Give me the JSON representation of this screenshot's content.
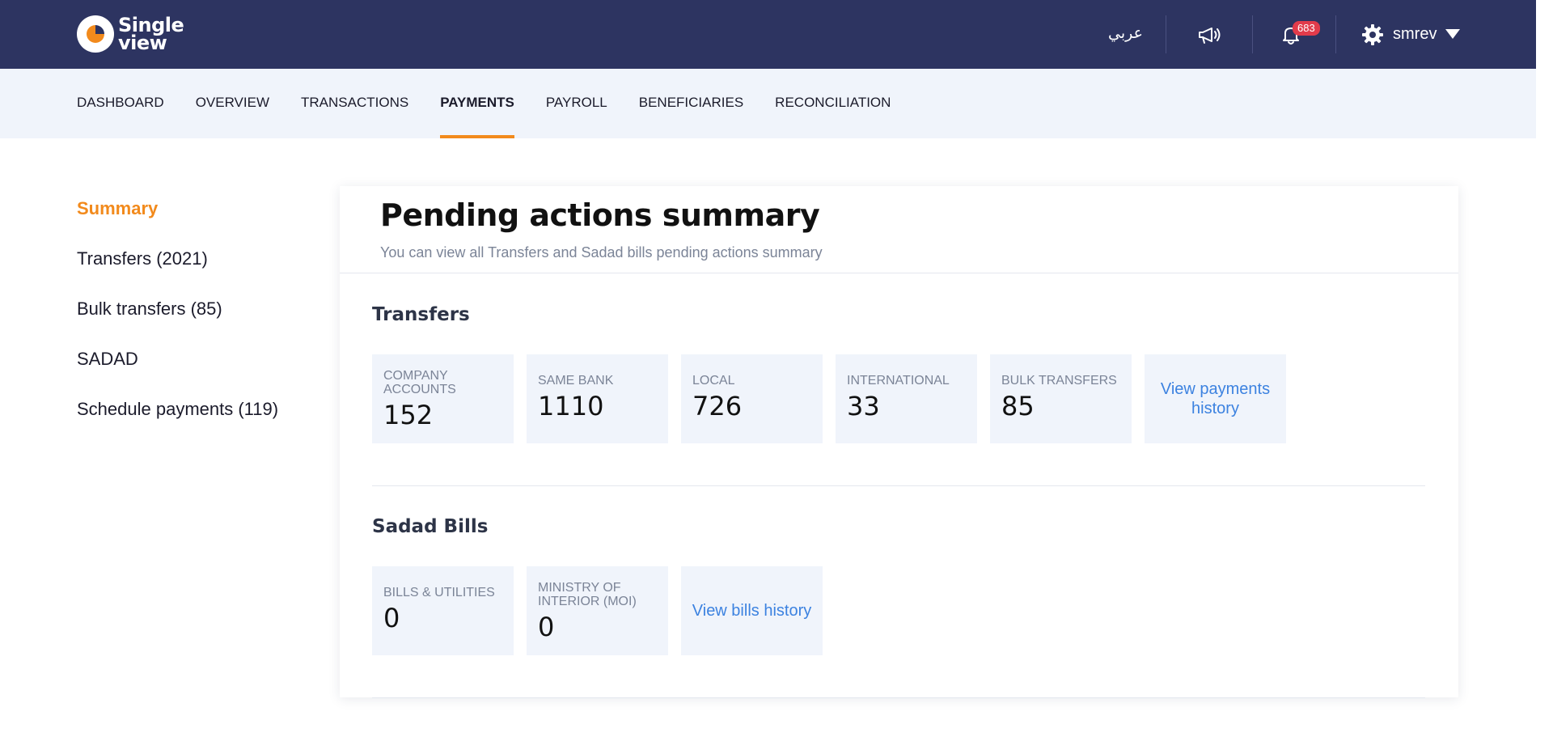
{
  "brand": {
    "line1": "Single",
    "line2": "view"
  },
  "header": {
    "language_label": "عربي",
    "notification_count": "683",
    "username": "smrev"
  },
  "nav": {
    "items": [
      {
        "label": "DASHBOARD"
      },
      {
        "label": "OVERVIEW"
      },
      {
        "label": "TRANSACTIONS"
      },
      {
        "label": "PAYMENTS",
        "active": true
      },
      {
        "label": "PAYROLL"
      },
      {
        "label": "BENEFICIARIES"
      },
      {
        "label": "RECONCILIATION"
      }
    ]
  },
  "sidebar": {
    "items": [
      {
        "label": "Summary",
        "active": true
      },
      {
        "label": "Transfers (2021)"
      },
      {
        "label": "Bulk transfers (85)"
      },
      {
        "label": "SADAD"
      },
      {
        "label": "Schedule payments (119)"
      }
    ]
  },
  "main": {
    "title": "Pending actions summary",
    "subtitle": "You can view all Transfers and Sadad bills pending actions summary",
    "transfers": {
      "title": "Transfers",
      "tiles": [
        {
          "label": "COMPANY ACCOUNTS",
          "value": "152"
        },
        {
          "label": "SAME BANK",
          "value": "1110"
        },
        {
          "label": "LOCAL",
          "value": "726"
        },
        {
          "label": "INTERNATIONAL",
          "value": "33"
        },
        {
          "label": "BULK TRANSFERS",
          "value": "85"
        }
      ],
      "history_link": "View payments history"
    },
    "sadad": {
      "title": "Sadad Bills",
      "tiles": [
        {
          "label": "BILLS & UTILITIES",
          "value": "0"
        },
        {
          "label": "MINISTRY OF INTERIOR (MOI)",
          "value": "0"
        }
      ],
      "history_link": "View bills history"
    }
  },
  "colors": {
    "header_bg": "#2d3461",
    "accent": "#f28a1c",
    "link": "#3c82e0",
    "tile_bg": "#f0f4fb",
    "badge": "#e23b4b"
  },
  "icons": [
    "logo-icon",
    "megaphone-icon",
    "bell-icon",
    "gear-icon",
    "caret-down-icon"
  ]
}
